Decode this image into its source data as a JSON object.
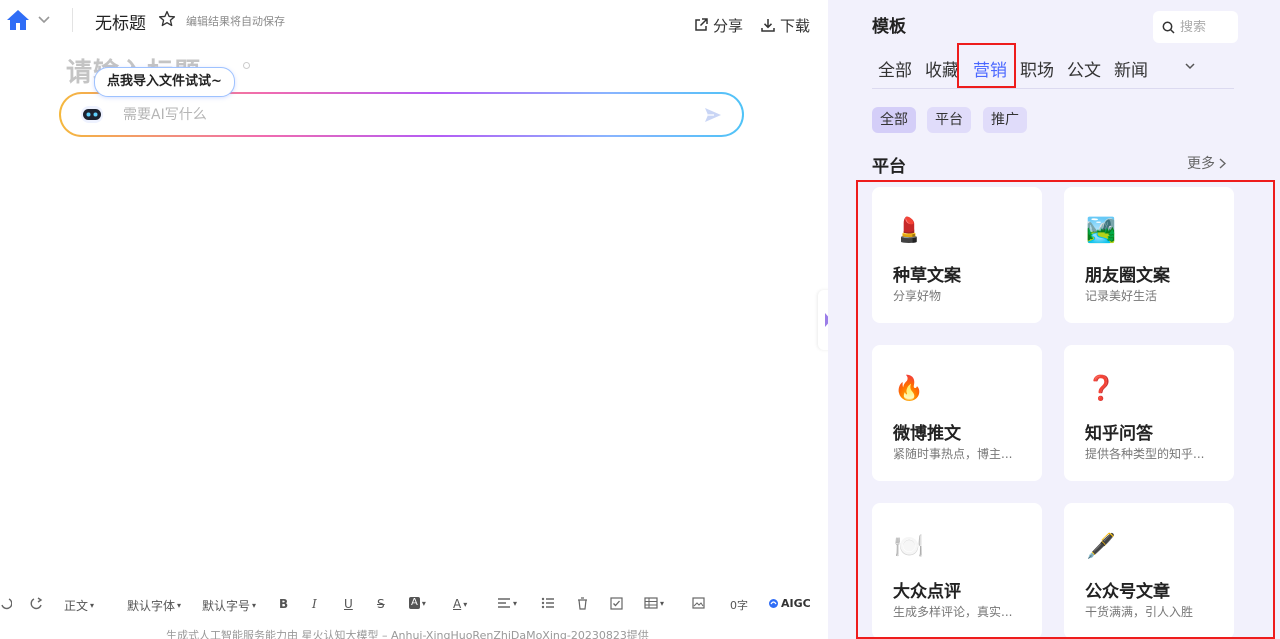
{
  "editor": {
    "doc_title": "无标题",
    "autosave_text": "编辑结果将自动保存",
    "share_label": "分享",
    "download_label": "下载",
    "title_placeholder": "请输入标题",
    "tooltip_text": "点我导入文件试试~",
    "ai_placeholder": "需要AI写什么",
    "footer_note": "生成式人工智能服务能力由 星火认知大模型 – Anhui-XingHuoRenZhiDaMoXing-20230823提供"
  },
  "toolbar": {
    "paragraph_label": "正文",
    "font_label": "默认字体",
    "size_label": "默认字号",
    "bold_label": "B",
    "italic_label": "I",
    "underline_label": "U",
    "strike_label": "S",
    "highlight_label": "A",
    "color_label": "A",
    "word_count": "0字",
    "aigc_label": "AIGC"
  },
  "panel": {
    "title": "模板",
    "search_placeholder": "搜索",
    "tabs": [
      {
        "label": "全部"
      },
      {
        "label": "收藏"
      },
      {
        "label": "营销",
        "active": true
      },
      {
        "label": "职场"
      },
      {
        "label": "公文"
      },
      {
        "label": "新闻"
      }
    ],
    "chips": [
      {
        "label": "全部",
        "active": true
      },
      {
        "label": "平台"
      },
      {
        "label": "推广"
      }
    ],
    "section_title": "平台",
    "more_label": "更多",
    "cards": [
      {
        "emoji": "💄",
        "title": "种草文案",
        "desc": "分享好物"
      },
      {
        "emoji": "🏞️",
        "title": "朋友圈文案",
        "desc": "记录美好生活"
      },
      {
        "emoji": "🔥",
        "title": "微博推文",
        "desc": "紧随时事热点，博主..."
      },
      {
        "emoji": "❓",
        "title": "知乎问答",
        "desc": "提供各种类型的知乎..."
      },
      {
        "emoji": "🍽️",
        "title": "大众点评",
        "desc": "生成多样评论，真实..."
      },
      {
        "emoji": "🖋️",
        "title": "公众号文章",
        "desc": "干货满满，引人入胜"
      }
    ]
  },
  "colors": {
    "accent": "#4a67ff",
    "panel_bg": "#f2f1fc",
    "chip_bg": "#e0dcfa",
    "highlight_red": "#ee1c1c"
  }
}
